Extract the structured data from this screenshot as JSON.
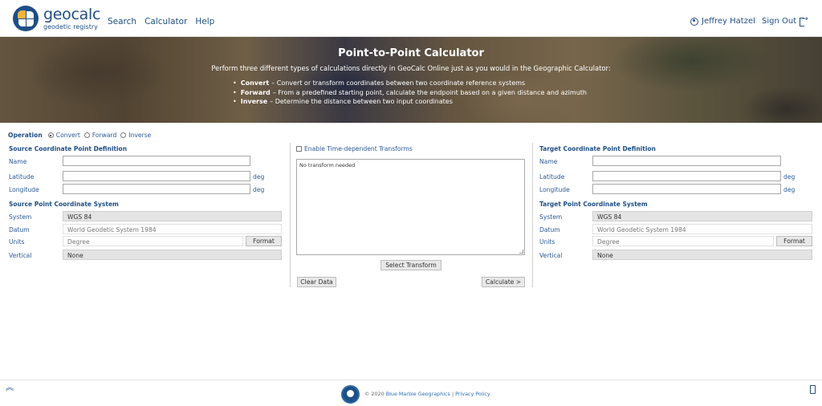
{
  "header": {
    "logo_name": "geocalc",
    "logo_sub": "geodetic registry",
    "nav": [
      "Search",
      "Calculator",
      "Help"
    ],
    "user_name": "Jeffrey Hatzel",
    "sign_out": "Sign Out"
  },
  "banner": {
    "title": "Point-to-Point Calculator",
    "lead": "Perform three different types of calculations directly in GeoCalc Online just as you would in the Geographic Calculator:",
    "items": [
      {
        "term": "Convert",
        "desc": "– Convert or transform coordinates between two coordinate reference systems"
      },
      {
        "term": "Forward",
        "desc": "– From a predefined starting point, calculate the endpoint based on a given distance and azimuth"
      },
      {
        "term": "Inverse",
        "desc": "– Determine the distance between two input coordinates"
      }
    ]
  },
  "operation": {
    "label": "Operation",
    "options": [
      "Convert",
      "Forward",
      "Inverse"
    ],
    "selected": "Convert"
  },
  "source": {
    "title": "Source Coordinate Point Definition",
    "name_label": "Name",
    "lat_label": "Latitude",
    "lon_label": "Longitude",
    "unit": "deg",
    "system_title": "Source Point Coordinate System",
    "system_label": "System",
    "system_value": "WGS 84",
    "datum_label": "Datum",
    "datum_value": "World Geodetic System 1984",
    "units_label": "Units",
    "units_value": "Degree",
    "format_button": "Format",
    "vertical_label": "Vertical",
    "vertical_value": "None"
  },
  "middle": {
    "time_dependent_label": "Enable Time-dependent Transforms",
    "time_dependent_checked": false,
    "transform_text": "No transform needed",
    "select_transform": "Select Transform",
    "clear_data": "Clear Data",
    "calculate": "Calculate >"
  },
  "target": {
    "title": "Target Coordinate Point Definition",
    "name_label": "Name",
    "lat_label": "Latitude",
    "lon_label": "Longitude",
    "unit": "deg",
    "system_title": "Target Point Coordinate System",
    "system_label": "System",
    "system_value": "WGS 84",
    "datum_label": "Datum",
    "datum_value": "World Geodetic System 1984",
    "units_label": "Units",
    "units_value": "Degree",
    "format_button": "Format",
    "vertical_label": "Vertical",
    "vertical_value": "None"
  },
  "footer": {
    "copyright": "© 2020",
    "company": "Blue Marble Geographics",
    "separator": "|",
    "privacy": "Privacy Policy"
  },
  "colors": {
    "brand_blue": "#1e4f86",
    "link_blue": "#2a5a96"
  }
}
